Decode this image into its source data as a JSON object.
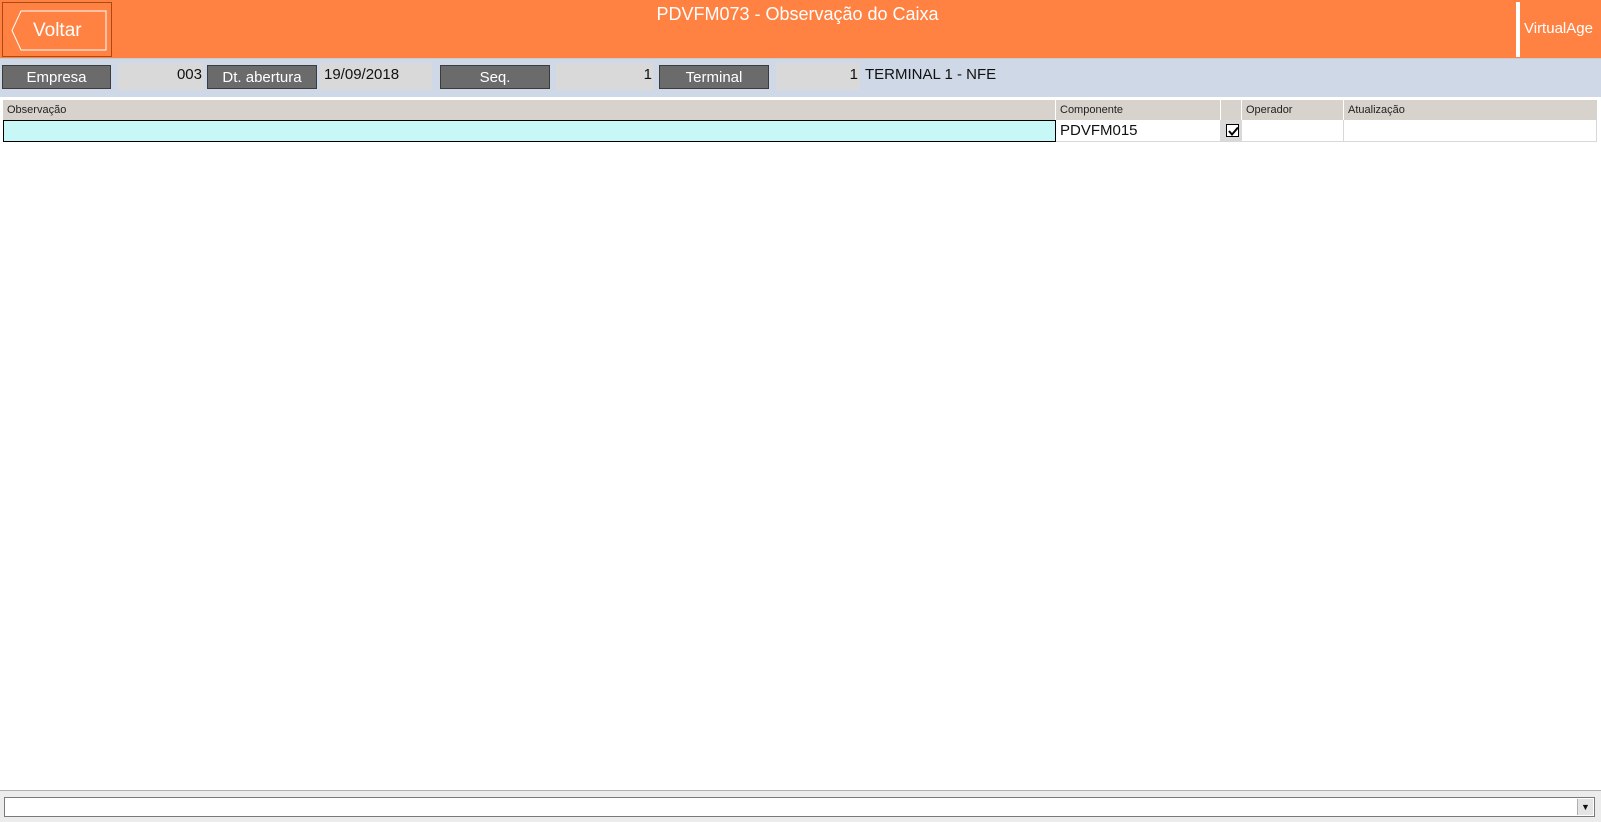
{
  "header": {
    "back_label": "Voltar",
    "title": "PDVFM073 - Observação do Caixa",
    "brand": "VirtualAge"
  },
  "info": {
    "empresa_label": "Empresa",
    "empresa_value": "003",
    "dt_abertura_label": "Dt. abertura",
    "dt_abertura_value": "19/09/2018",
    "seq_label": "Seq.",
    "seq_value": "1",
    "terminal_label": "Terminal",
    "terminal_value": "1",
    "terminal_name": "TERMINAL 1 - NFE"
  },
  "grid": {
    "columns": {
      "observacao": "Observação",
      "componente": "Componente",
      "check": "",
      "operador": "Operador",
      "atualizacao": "Atualização"
    },
    "rows": [
      {
        "observacao": "",
        "componente": "PDVFM015",
        "checked": true,
        "operador": "",
        "atualizacao": ""
      }
    ]
  },
  "bottom": {
    "combo_value": ""
  },
  "colors": {
    "header_bg": "#ff8243",
    "label_btn_bg": "#6b6b6b",
    "active_cell_bg": "#c8f7f7"
  },
  "icons": {
    "back": "chevron-left-outline-icon",
    "check": "checkmark-icon",
    "dropdown": "chevron-down-icon"
  }
}
